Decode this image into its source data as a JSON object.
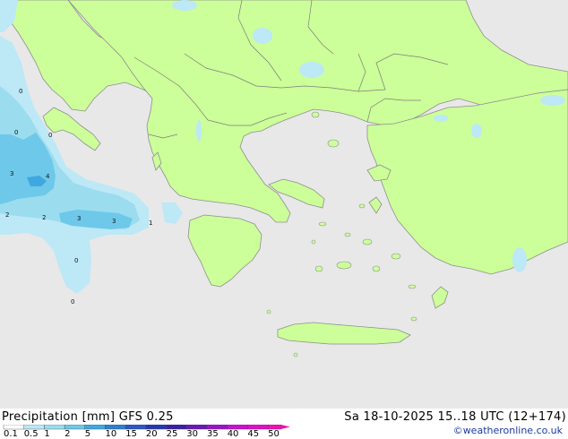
{
  "header": {
    "title": "Precipitation [mm]  GFS 0.25",
    "datetime": "Sa 18-10-2025 15..18 UTC (12+174)",
    "credit": "©weatheronline.co.uk"
  },
  "legend": {
    "ticks": [
      "0.1",
      "0.5",
      "1",
      "2",
      "5",
      "10",
      "15",
      "20",
      "25",
      "30",
      "35",
      "40",
      "45",
      "50"
    ],
    "colors": [
      "#ffffff",
      "#bde8f6",
      "#9bdcef",
      "#6ec8ea",
      "#3fa8e0",
      "#2f7fd2",
      "#2a58c4",
      "#2638b0",
      "#3a1fa8",
      "#6a18b8",
      "#9a14c8",
      "#c812d0",
      "#e010c8",
      "#f010b4"
    ]
  },
  "map": {
    "colors": {
      "land": "#ccff99",
      "sea": "#e8e8e8",
      "coast": "#9a9a9a",
      "border": "#7d7d7d"
    },
    "precip_labels": [
      "0",
      "0",
      "0",
      "3",
      "4",
      "2",
      "2",
      "3",
      "3",
      "1",
      "0",
      "0"
    ]
  }
}
